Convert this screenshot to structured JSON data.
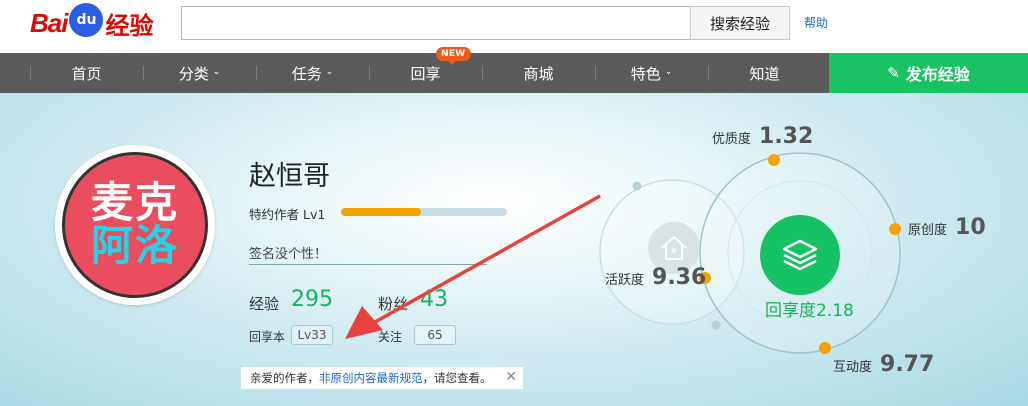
{
  "header": {
    "logo_text_left": "Bai",
    "logo_paw_text": "du",
    "logo_text_right": "经验",
    "search_button": "搜索经验",
    "help_link": "帮助"
  },
  "nav": {
    "items": [
      {
        "label": "首页",
        "caret": ""
      },
      {
        "label": "分类",
        "caret": "⌄"
      },
      {
        "label": "任务",
        "caret": "⌄"
      },
      {
        "label": "回享",
        "caret": ""
      },
      {
        "label": "商城",
        "caret": ""
      },
      {
        "label": "特色",
        "caret": "⌄"
      },
      {
        "label": "知道",
        "caret": ""
      }
    ],
    "new_badge": "NEW",
    "publish_label": "发布经验",
    "publish_color": "#19c364"
  },
  "profile": {
    "avatar_line1": "麦克",
    "avatar_line2": "阿洛",
    "name": "赵恒哥",
    "level_text": "特约作者 Lv1",
    "level_progress_percent": 48,
    "signature": "签名没个性！",
    "exp_label": "经验",
    "exp_value": "295",
    "fans_label": "粉丝",
    "fans_value": "43",
    "huixiang_label": "回享本",
    "huixiang_value": "Lv33",
    "follow_label": "关注",
    "follow_value": "65"
  },
  "notice": {
    "prefix": "亲爱的作者，",
    "link": "非原创内容最新规范",
    "suffix": "，请您查看。",
    "close": "✕"
  },
  "metrics": {
    "quality_label": "优质度",
    "quality_value": "1.32",
    "original_label": "原创度",
    "original_value": "10",
    "activity_label": "活跃度",
    "activity_value": "9.36",
    "interaction_label": "互动度",
    "interaction_value": "9.77",
    "share_label": "回享度2.18"
  }
}
